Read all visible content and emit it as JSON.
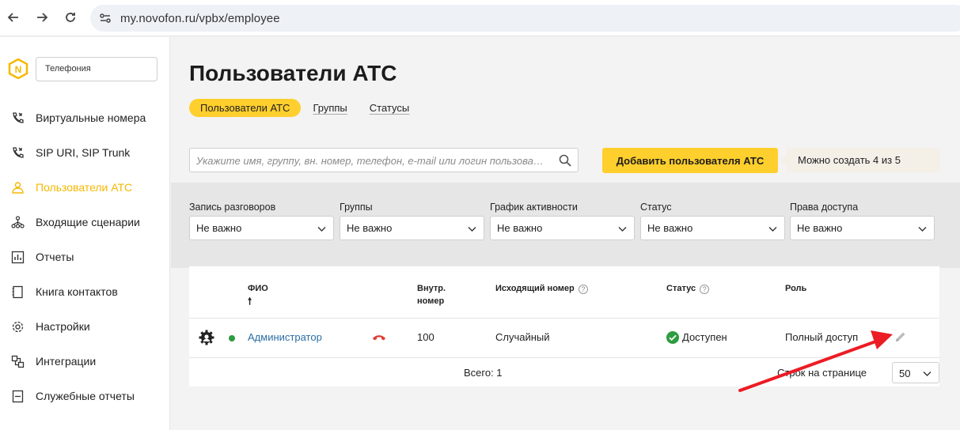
{
  "browser": {
    "url": "my.novofon.ru/vpbx/employee"
  },
  "sidebar": {
    "product": "Телефония",
    "items": [
      {
        "label": "Виртуальные номера",
        "icon": "phone-forward-icon"
      },
      {
        "label": "SIP URI, SIP Trunk",
        "icon": "phone-forward-icon"
      },
      {
        "label": "Пользователи АТС",
        "icon": "user-icon",
        "active": true
      },
      {
        "label": "Входящие сценарии",
        "icon": "scenario-tree-icon"
      },
      {
        "label": "Отчеты",
        "icon": "report-icon"
      },
      {
        "label": "Книга контактов",
        "icon": "contacts-book-icon"
      },
      {
        "label": "Настройки",
        "icon": "gear-icon"
      },
      {
        "label": "Интеграции",
        "icon": "integration-icon"
      },
      {
        "label": "Служебные отчеты",
        "icon": "service-report-icon"
      }
    ]
  },
  "main": {
    "title": "Пользователи АТС",
    "tabs": [
      "Пользователи АТС",
      "Группы",
      "Статусы"
    ],
    "search_placeholder": "Укажите имя, группу, вн. номер, телефон, e-mail или логин пользователя",
    "add_button": "Добавить пользователя АТС",
    "limit_note": "Можно создать 4 из 5"
  },
  "filters": [
    {
      "label": "Запись разговоров",
      "value": "Не важно"
    },
    {
      "label": "Группы",
      "value": "Не важно"
    },
    {
      "label": "График активности",
      "value": "Не важно"
    },
    {
      "label": "Статус",
      "value": "Не важно"
    },
    {
      "label": "Права доступа",
      "value": "Не важно"
    }
  ],
  "table": {
    "headers": {
      "name": "ФИО",
      "ext_1": "Внутр.",
      "ext_2": "номер",
      "outgoing": "Исходящий номер",
      "status": "Статус",
      "role": "Роль"
    },
    "rows": [
      {
        "name": "Администратор",
        "ext": "100",
        "outgoing": "Случайный",
        "status": "Доступен",
        "role": "Полный доступ"
      }
    ],
    "total": "Всего: 1",
    "rows_per_page_label": "Строк на странице",
    "rows_per_page": "50"
  },
  "colors": {
    "accent": "#ffcf2d",
    "link": "#2d6ea3",
    "online": "#2e9c3f",
    "arrow": "#ec1c24"
  }
}
